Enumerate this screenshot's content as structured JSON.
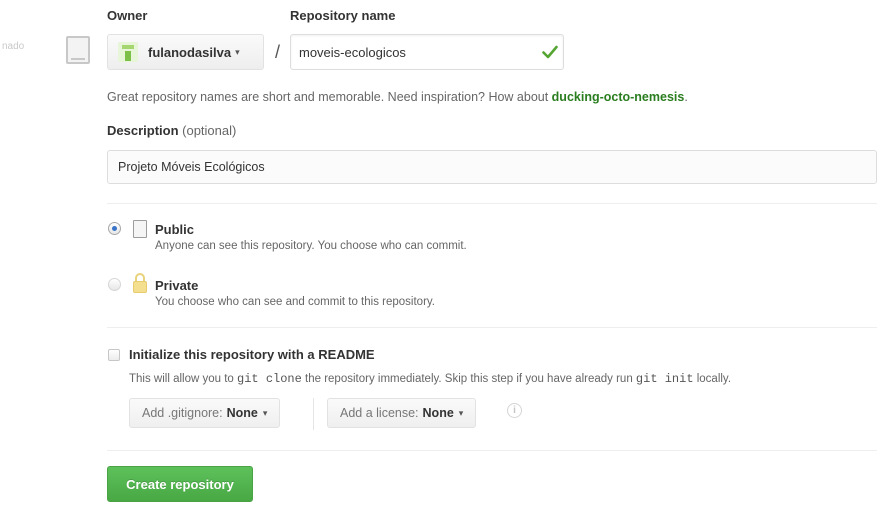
{
  "left_label": "nado",
  "owner": {
    "label": "Owner",
    "value": "fulanodasilva",
    "avatar_icon": "identicon-avatar",
    "caret": "▾"
  },
  "separator": "/",
  "repository": {
    "label": "Repository name",
    "value": "moveis-ecologicos",
    "status_icon": "check-icon",
    "status_color": "#55a532"
  },
  "hint": {
    "text": "Great repository names are short and memorable. Need inspiration? How about ",
    "suggestion": "ducking-octo-nemesis",
    "suffix": "."
  },
  "description": {
    "label": "Description",
    "optional": "(optional)",
    "value": "Projeto Móveis Ecológicos"
  },
  "visibility": {
    "public": {
      "title": "Public",
      "desc": "Anyone can see this repository. You choose who can commit.",
      "selected": true,
      "icon": "repo-book-icon"
    },
    "private": {
      "title": "Private",
      "desc": "You choose who can see and commit to this repository.",
      "selected": false,
      "icon": "lock-icon"
    }
  },
  "readme": {
    "title": "Initialize this repository with a README",
    "desc_1": "This will allow you to ",
    "code_1": "git clone",
    "desc_2": " the repository immediately. Skip this step if you have already run ",
    "code_2": "git init",
    "desc_3": " locally.",
    "checked": false
  },
  "gitignore": {
    "label": "Add .gitignore:",
    "value": "None"
  },
  "license": {
    "label": "Add a license:",
    "value": "None"
  },
  "info_glyph": "i",
  "create_button": "Create repository",
  "colors": {
    "accent_green": "#48a844",
    "link_green": "#2a7d1f",
    "radio_blue": "#3a74c9"
  }
}
